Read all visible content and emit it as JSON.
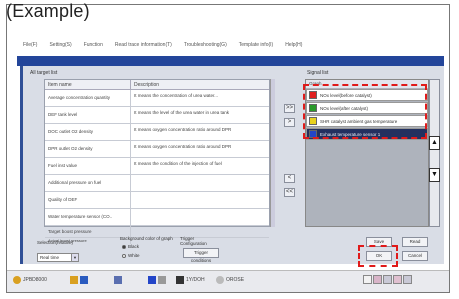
{
  "caption": "(Example)",
  "menu": {
    "items": [
      "File(F)",
      "Setting(S)",
      "Function",
      "Read trace information(T)",
      "Troubleshooting(G)",
      "Template info(I)",
      "Help(H)"
    ]
  },
  "window": {
    "title": ""
  },
  "left_panel": {
    "title": "All target list",
    "headers": [
      "Item name",
      "Description"
    ],
    "rows": [
      {
        "name": "Average concentration quantity",
        "desc": "It means the concentration of urea water..."
      },
      {
        "name": "DEF tank level",
        "desc": "It means the level of the urea water in urea tank"
      },
      {
        "name": "DOC outlet O2 density",
        "desc": "It means oxygen concentration ratio around DPR"
      },
      {
        "name": "DPR outlet O2 density",
        "desc": "It means oxygen concentration ratio around DPR"
      },
      {
        "name": "Fuel inst value",
        "desc": "It means the condition of the injection of fuel"
      },
      {
        "name": "Additional pressure on fuel",
        "desc": ""
      },
      {
        "name": "Quality of DEF",
        "desc": ""
      },
      {
        "name": "Water temperature sensor (CO..",
        "desc": ""
      },
      {
        "name": "Target boost pressure",
        "desc": ""
      },
      {
        "name": "Actual boost pressure",
        "desc": ""
      }
    ]
  },
  "move_buttons": {
    "add": ">>",
    "add_one": ">",
    "remove_one": "<",
    "remove_all": "<<"
  },
  "right_panel": {
    "title": "Signal list",
    "header": "Graph",
    "items": [
      {
        "label": "NOx level(before catalyst)",
        "color": "#e02020",
        "selected": false
      },
      {
        "label": "NOx level(after catalyst)",
        "color": "#2a9a2a",
        "selected": false
      },
      {
        "label": "SHR catalyst ambient gas temperature",
        "color": "#e8d21f",
        "selected": false
      },
      {
        "label": "Exhaust temperature sensor 1",
        "color": "#2345c8",
        "selected": true
      }
    ],
    "side_buttons": {
      "up": "▲",
      "down": "▼"
    }
  },
  "options": {
    "selection_label": "Selection(relative)",
    "selection_value": "Real time",
    "background_label": "Background color of graph",
    "background_options": [
      {
        "label": "Black",
        "checked": true
      },
      {
        "label": "White",
        "checked": false
      }
    ],
    "trigger_label": "Trigger",
    "trigger_sub": "Configuration",
    "trigger_button": "Trigger conditions"
  },
  "buttons": {
    "save": "Save",
    "read": "Read",
    "ok": "OK",
    "cancel": "Cancel"
  },
  "taskbar": {
    "items": [
      "JPBD8000",
      "",
      "",
      "",
      "1Y/DOH",
      "OROSE"
    ]
  },
  "colors": {
    "highlight": "#e01a1a",
    "title_bar": "#23459a",
    "selected_row": "#23305f"
  }
}
